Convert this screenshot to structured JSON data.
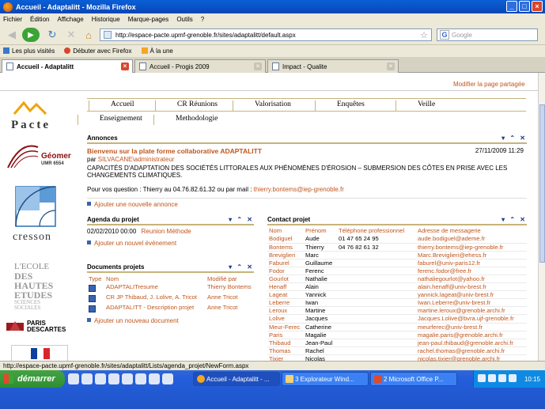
{
  "window": {
    "title": "Accueil - Adaptalitt - Mozilla Firefox",
    "controls": [
      "_",
      "□",
      "×"
    ]
  },
  "menubar": [
    "Fichier",
    "Édition",
    "Affichage",
    "Historique",
    "Marque-pages",
    "Outils",
    "?"
  ],
  "navbar": {
    "url": "http://espace-pacte.upmf-grenoble.fr/sites/adaptalitt/default.aspx",
    "search_placeholder": "Google"
  },
  "bookmarks": [
    "Les plus visités",
    "Débuter avec Firefox",
    "À la une"
  ],
  "tabs": [
    {
      "label": "Accueil - Adaptalitt",
      "active": true
    },
    {
      "label": "Accueil - Progis 2009",
      "active": false
    },
    {
      "label": "Impact - Qualite",
      "active": false
    }
  ],
  "page": {
    "modify_link": "Modifier la page partagée",
    "logos": {
      "pacte": "Pacte",
      "geomer": "Géomer",
      "geomer_sub": "UMR 6554",
      "cresson": "cresson",
      "ehess": [
        "L'ECOLE",
        "DES HAUTES",
        "ETUDES",
        "SCIENCES SOCIALES"
      ],
      "paris": [
        "PARIS",
        "DESCARTES"
      ]
    },
    "menu_row1": [
      "Accueil",
      "CR Réunions",
      "Valorisation",
      "Enquêtes",
      "Veille"
    ],
    "menu_row2": [
      "Enseignement",
      "Methodologie"
    ],
    "tools_glyphs": "▾ ⌃ ✕",
    "annonces": {
      "title": "Annonces",
      "headline": "Bienvenu sur la plate forme collaborative ADAPTALITT",
      "author_prefix": "par",
      "author": "SILVACANE\\administrateur",
      "date": "27/11/2009 11:29",
      "body": "CAPACITÉS D'ADAPTATION DES SOCIÉTÉS LITTORALES AUX PHÉNOMÈNES D'ÉROSION – SUBMERSION DES CÔTES EN PRISE AVEC LES CHANGEMENTS CLIMATIQUES.",
      "contact_line": "Pour vos question : Thierry au 04.76.82.61.32 ou par mail :",
      "contact_email": "thierry.bontems@iep-grenoble.fr",
      "add_link": "Ajouter une nouvelle annonce"
    },
    "agenda": {
      "title": "Agenda du projet",
      "events": [
        {
          "date": "02/02/2010 00:00",
          "title": "Reunion Méthode"
        }
      ],
      "add_link": "Ajouter un nouvel événement"
    },
    "documents": {
      "title": "Documents projets",
      "headers": [
        "Type",
        "Nom",
        "Modifié par"
      ],
      "rows": [
        {
          "name": "ADAPTALITresume",
          "by": "Thierry Bontems"
        },
        {
          "name": "CR JP Thibaud, J. Lolive, A. Tricot",
          "by": "Anne Tricot"
        },
        {
          "name": "ADAPTALITT - Description projet",
          "by": "Anne Tricot"
        }
      ],
      "add_link": "Ajouter un nouveau document"
    },
    "contacts": {
      "title": "Contact projet",
      "headers": [
        "Nom",
        "Prénom",
        "Téléphone professionnel",
        "Adresse de messagerie"
      ],
      "rows": [
        {
          "nom": "Bodiguel",
          "prenom": "Aude",
          "tel": "01 47 65 24 95",
          "mail": "aude.bodiguel@ademe.fr"
        },
        {
          "nom": "Bontems",
          "prenom": "Thierry",
          "tel": "04 76 82 61 32",
          "mail": "thierry.bontems@iep-grenoble.fr"
        },
        {
          "nom": "Breviglieri",
          "prenom": "Marc",
          "tel": "",
          "mail": "Marc.Breviglieri@ehess.fr"
        },
        {
          "nom": "Faburel",
          "prenom": "Guillaume",
          "tel": "",
          "mail": "faburel@univ-paris12.fr"
        },
        {
          "nom": "Fodor",
          "prenom": "Ferenc",
          "tel": "",
          "mail": "ferenc.fodor@free.fr"
        },
        {
          "nom": "Gourlot",
          "prenom": "Nathalie",
          "tel": "",
          "mail": "nathaliegourlot@yahoo.fr"
        },
        {
          "nom": "Henaff",
          "prenom": "Alain",
          "tel": "",
          "mail": "alain.henaff@univ-brest.fr"
        },
        {
          "nom": "Lageat",
          "prenom": "Yannick",
          "tel": "",
          "mail": "yannick.lageat@univ-brest.fr"
        },
        {
          "nom": "Leberre",
          "prenom": "Iwan",
          "tel": "",
          "mail": "Iwan.Leberre@univ-brest.fr"
        },
        {
          "nom": "Leroux",
          "prenom": "Martine",
          "tel": "",
          "mail": "martine.leroux@grenoble.archi.fr"
        },
        {
          "nom": "Lolive",
          "prenom": "Jacques",
          "tel": "",
          "mail": "Jacques.Lolive@bvra.ujf-grenoble.fr"
        },
        {
          "nom": "Meur-Ferec",
          "prenom": "Catherine",
          "tel": "",
          "mail": "meurferec@univ-brest.fr"
        },
        {
          "nom": "Paris",
          "prenom": "Magalie",
          "tel": "",
          "mail": "magalie.paris@grenoble.archi.fr"
        },
        {
          "nom": "Thibaud",
          "prenom": "Jean-Paul",
          "tel": "",
          "mail": "jean-paul.thibaud@grenoble.archi.fr"
        },
        {
          "nom": "Thomas",
          "prenom": "Rachel",
          "tel": "",
          "mail": "rachel.thomas@grenoble.archi.fr"
        },
        {
          "nom": "Tixier",
          "prenom": "Nicolas",
          "tel": "",
          "mail": "nicolas.tixier@grenoble.archi.fr"
        }
      ]
    }
  },
  "statusbar": "http://espace-pacte.upmf-grenoble.fr/sites/adaptalitt/Lists/agenda_projet/NewForm.aspx",
  "taskbar": {
    "start": "démarrer",
    "tasks": [
      {
        "label": "Accueil - Adaptalitt - ...",
        "active": true
      },
      {
        "label": "3 Explorateur Wind...",
        "active": false
      },
      {
        "label": "2 Microsoft Office P...",
        "active": false
      }
    ],
    "clock": "10:15"
  },
  "colors": {
    "accent": "#c0561c",
    "menu_border": "#c7b37a",
    "taskbar": "#245edb"
  }
}
